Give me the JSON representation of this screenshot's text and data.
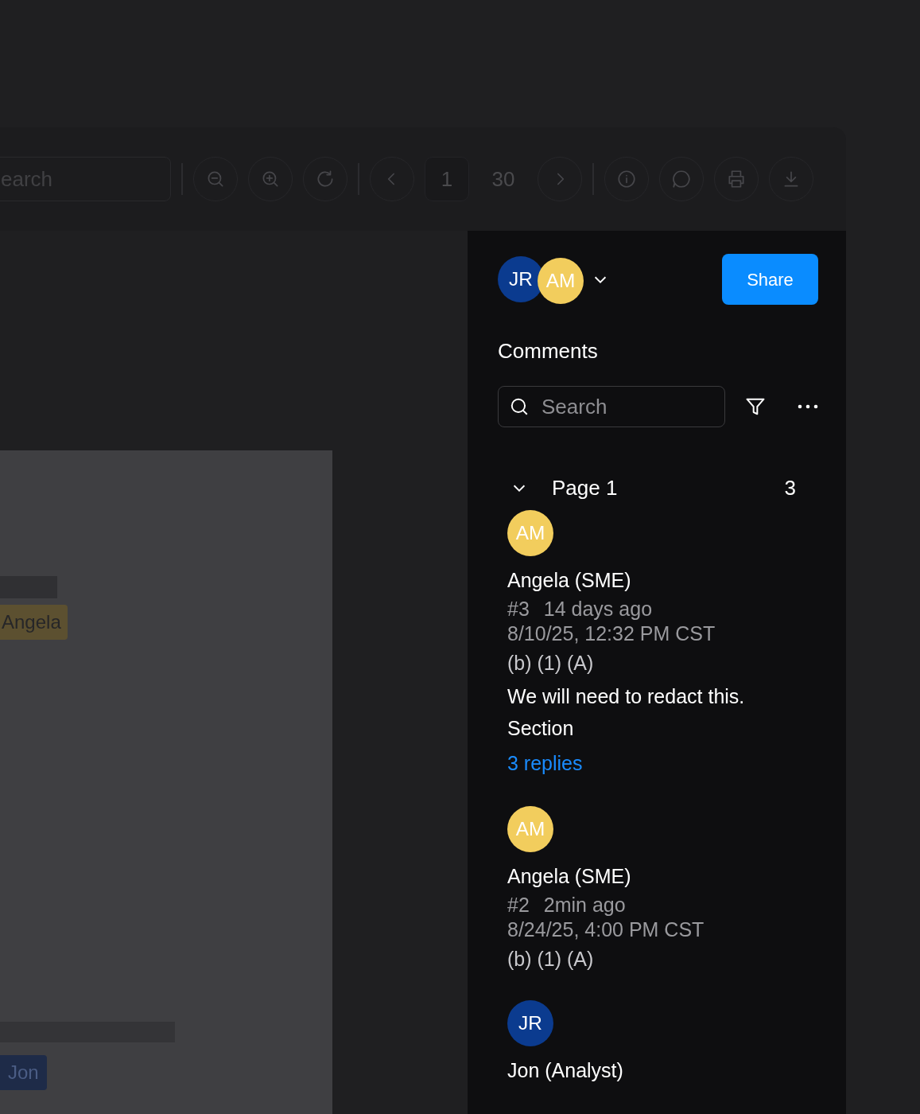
{
  "toolbar": {
    "search": {
      "placeholder": "earch"
    },
    "page_input": {
      "value": "1"
    },
    "page_count": "30"
  },
  "document": {
    "tags": [
      {
        "label": "Angela",
        "color": "#5c5030"
      },
      {
        "label": "Jon",
        "color": "#1e2b48"
      }
    ]
  },
  "panel": {
    "collaborators": [
      {
        "initials": "JR",
        "color": "#0b3b8f"
      },
      {
        "initials": "AM",
        "color": "#f2cd5d"
      }
    ],
    "share_button": "Share",
    "title": "Comments",
    "search": {
      "placeholder": "Search"
    },
    "groups": [
      {
        "label": "Page 1",
        "count": "3",
        "expanded": true,
        "comments": [
          {
            "initials": "AM",
            "color": "#f2cd5d",
            "author": "Angela (SME)",
            "number": "#3",
            "time_ago": "14 days ago",
            "timestamp": "8/10/25, 12:32 PM CST",
            "section": "(b) (1) (A)",
            "body": "We will need to redact this. Section",
            "replies": "3 replies"
          },
          {
            "initials": "AM",
            "color": "#f2cd5d",
            "author": "Angela (SME)",
            "number": "#2",
            "time_ago": "2min ago",
            "timestamp": "8/24/25, 4:00 PM CST",
            "section": "(b) (1) (A)"
          },
          {
            "initials": "JR",
            "color": "#0b3b8f",
            "author": "Jon (Analyst)"
          }
        ]
      }
    ]
  }
}
